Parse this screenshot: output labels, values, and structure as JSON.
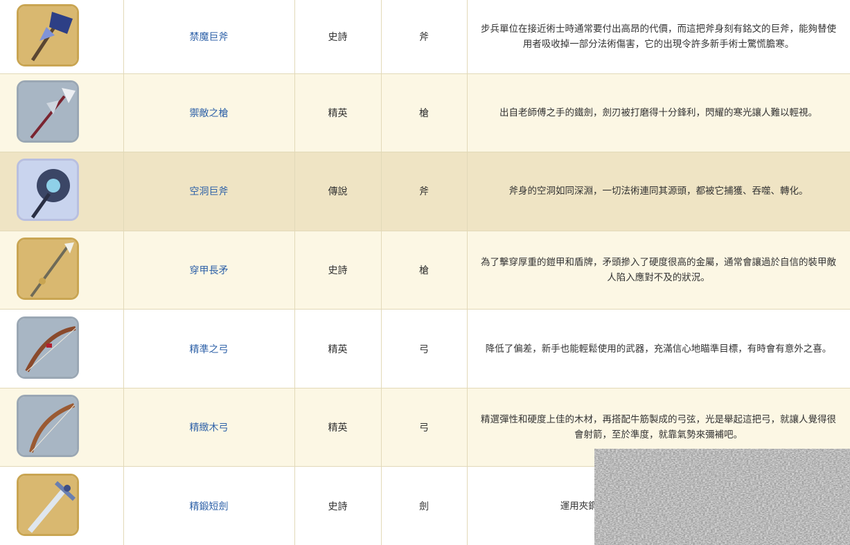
{
  "weapons": [
    {
      "name": "禁魔巨斧",
      "rarity": "史詩",
      "type": "斧",
      "icon": "axe-icon",
      "frame": "epic",
      "row": "white",
      "desc": "步兵單位在接近術士時通常要付出高昂的代價，而這把斧身刻有銘文的巨斧，能夠替使用者吸收掉一部分法術傷害，它的出現令許多新手術士驚慌膽寒。"
    },
    {
      "name": "禦敵之槍",
      "rarity": "精英",
      "type": "槍",
      "icon": "spear-icon",
      "frame": "elite",
      "row": "cream",
      "desc": "出自老師傅之手的鐵劍，劍刃被打磨得十分鋒利，閃耀的寒光讓人難以輕視。"
    },
    {
      "name": "空洞巨斧",
      "rarity": "傳說",
      "type": "斧",
      "icon": "void-axe-icon",
      "frame": "legend",
      "row": "tan",
      "desc": "斧身的空洞如同深淵，一切法術連同其源頭，都被它捕獲、吞噬、轉化。"
    },
    {
      "name": "穿甲長矛",
      "rarity": "史詩",
      "type": "槍",
      "icon": "lance-icon",
      "frame": "epic",
      "row": "cream",
      "desc": "為了擊穿厚重的鎧甲和盾牌，矛頭摻入了硬度很高的金屬，通常會讓過於自信的裝甲敵人陷入應對不及的狀況。"
    },
    {
      "name": "精準之弓",
      "rarity": "精英",
      "type": "弓",
      "icon": "bow-icon",
      "frame": "elite",
      "row": "white",
      "desc": "降低了偏差，新手也能輕鬆使用的武器，充滿信心地瞄準目標，有時會有意外之喜。"
    },
    {
      "name": "精緻木弓",
      "rarity": "精英",
      "type": "弓",
      "icon": "wooden-bow-icon",
      "frame": "elite",
      "row": "cream",
      "desc": "精選彈性和硬度上佳的木材，再搭配牛筋製成的弓弦，光是舉起這把弓，就讓人覺得很會射箭，至於準度，就靠氣勢來彌補吧。"
    },
    {
      "name": "精鍛短劍",
      "rarity": "史詩",
      "type": "劍",
      "icon": "short-sword-icon",
      "frame": "epic",
      "row": "white",
      "desc": "運用夾鋼工藝鍛造，劍刃鋒利，價格過於昂貴。"
    }
  ]
}
